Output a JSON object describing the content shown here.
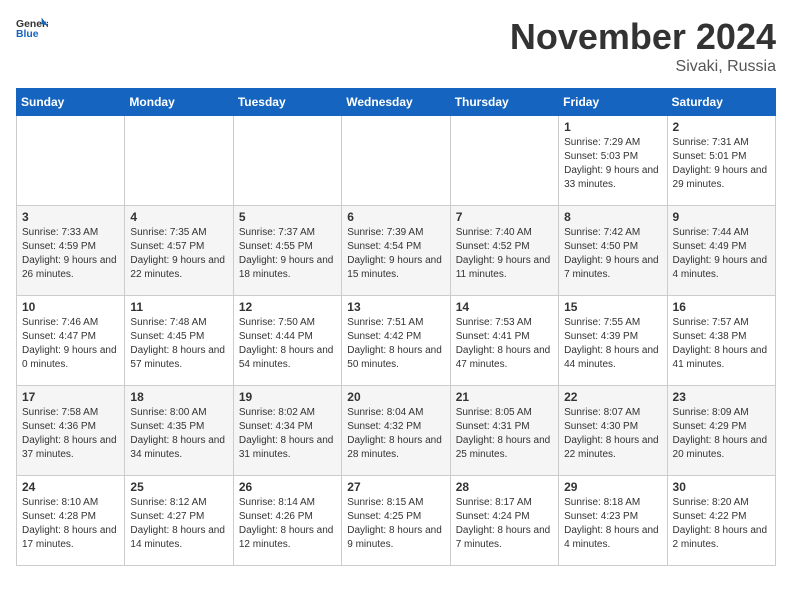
{
  "header": {
    "logo_general": "General",
    "logo_blue": "Blue",
    "month": "November 2024",
    "location": "Sivaki, Russia"
  },
  "days_of_week": [
    "Sunday",
    "Monday",
    "Tuesday",
    "Wednesday",
    "Thursday",
    "Friday",
    "Saturday"
  ],
  "weeks": [
    [
      {
        "day": "",
        "info": ""
      },
      {
        "day": "",
        "info": ""
      },
      {
        "day": "",
        "info": ""
      },
      {
        "day": "",
        "info": ""
      },
      {
        "day": "",
        "info": ""
      },
      {
        "day": "1",
        "info": "Sunrise: 7:29 AM\nSunset: 5:03 PM\nDaylight: 9 hours and 33 minutes."
      },
      {
        "day": "2",
        "info": "Sunrise: 7:31 AM\nSunset: 5:01 PM\nDaylight: 9 hours and 29 minutes."
      }
    ],
    [
      {
        "day": "3",
        "info": "Sunrise: 7:33 AM\nSunset: 4:59 PM\nDaylight: 9 hours and 26 minutes."
      },
      {
        "day": "4",
        "info": "Sunrise: 7:35 AM\nSunset: 4:57 PM\nDaylight: 9 hours and 22 minutes."
      },
      {
        "day": "5",
        "info": "Sunrise: 7:37 AM\nSunset: 4:55 PM\nDaylight: 9 hours and 18 minutes."
      },
      {
        "day": "6",
        "info": "Sunrise: 7:39 AM\nSunset: 4:54 PM\nDaylight: 9 hours and 15 minutes."
      },
      {
        "day": "7",
        "info": "Sunrise: 7:40 AM\nSunset: 4:52 PM\nDaylight: 9 hours and 11 minutes."
      },
      {
        "day": "8",
        "info": "Sunrise: 7:42 AM\nSunset: 4:50 PM\nDaylight: 9 hours and 7 minutes."
      },
      {
        "day": "9",
        "info": "Sunrise: 7:44 AM\nSunset: 4:49 PM\nDaylight: 9 hours and 4 minutes."
      }
    ],
    [
      {
        "day": "10",
        "info": "Sunrise: 7:46 AM\nSunset: 4:47 PM\nDaylight: 9 hours and 0 minutes."
      },
      {
        "day": "11",
        "info": "Sunrise: 7:48 AM\nSunset: 4:45 PM\nDaylight: 8 hours and 57 minutes."
      },
      {
        "day": "12",
        "info": "Sunrise: 7:50 AM\nSunset: 4:44 PM\nDaylight: 8 hours and 54 minutes."
      },
      {
        "day": "13",
        "info": "Sunrise: 7:51 AM\nSunset: 4:42 PM\nDaylight: 8 hours and 50 minutes."
      },
      {
        "day": "14",
        "info": "Sunrise: 7:53 AM\nSunset: 4:41 PM\nDaylight: 8 hours and 47 minutes."
      },
      {
        "day": "15",
        "info": "Sunrise: 7:55 AM\nSunset: 4:39 PM\nDaylight: 8 hours and 44 minutes."
      },
      {
        "day": "16",
        "info": "Sunrise: 7:57 AM\nSunset: 4:38 PM\nDaylight: 8 hours and 41 minutes."
      }
    ],
    [
      {
        "day": "17",
        "info": "Sunrise: 7:58 AM\nSunset: 4:36 PM\nDaylight: 8 hours and 37 minutes."
      },
      {
        "day": "18",
        "info": "Sunrise: 8:00 AM\nSunset: 4:35 PM\nDaylight: 8 hours and 34 minutes."
      },
      {
        "day": "19",
        "info": "Sunrise: 8:02 AM\nSunset: 4:34 PM\nDaylight: 8 hours and 31 minutes."
      },
      {
        "day": "20",
        "info": "Sunrise: 8:04 AM\nSunset: 4:32 PM\nDaylight: 8 hours and 28 minutes."
      },
      {
        "day": "21",
        "info": "Sunrise: 8:05 AM\nSunset: 4:31 PM\nDaylight: 8 hours and 25 minutes."
      },
      {
        "day": "22",
        "info": "Sunrise: 8:07 AM\nSunset: 4:30 PM\nDaylight: 8 hours and 22 minutes."
      },
      {
        "day": "23",
        "info": "Sunrise: 8:09 AM\nSunset: 4:29 PM\nDaylight: 8 hours and 20 minutes."
      }
    ],
    [
      {
        "day": "24",
        "info": "Sunrise: 8:10 AM\nSunset: 4:28 PM\nDaylight: 8 hours and 17 minutes."
      },
      {
        "day": "25",
        "info": "Sunrise: 8:12 AM\nSunset: 4:27 PM\nDaylight: 8 hours and 14 minutes."
      },
      {
        "day": "26",
        "info": "Sunrise: 8:14 AM\nSunset: 4:26 PM\nDaylight: 8 hours and 12 minutes."
      },
      {
        "day": "27",
        "info": "Sunrise: 8:15 AM\nSunset: 4:25 PM\nDaylight: 8 hours and 9 minutes."
      },
      {
        "day": "28",
        "info": "Sunrise: 8:17 AM\nSunset: 4:24 PM\nDaylight: 8 hours and 7 minutes."
      },
      {
        "day": "29",
        "info": "Sunrise: 8:18 AM\nSunset: 4:23 PM\nDaylight: 8 hours and 4 minutes."
      },
      {
        "day": "30",
        "info": "Sunrise: 8:20 AM\nSunset: 4:22 PM\nDaylight: 8 hours and 2 minutes."
      }
    ]
  ]
}
